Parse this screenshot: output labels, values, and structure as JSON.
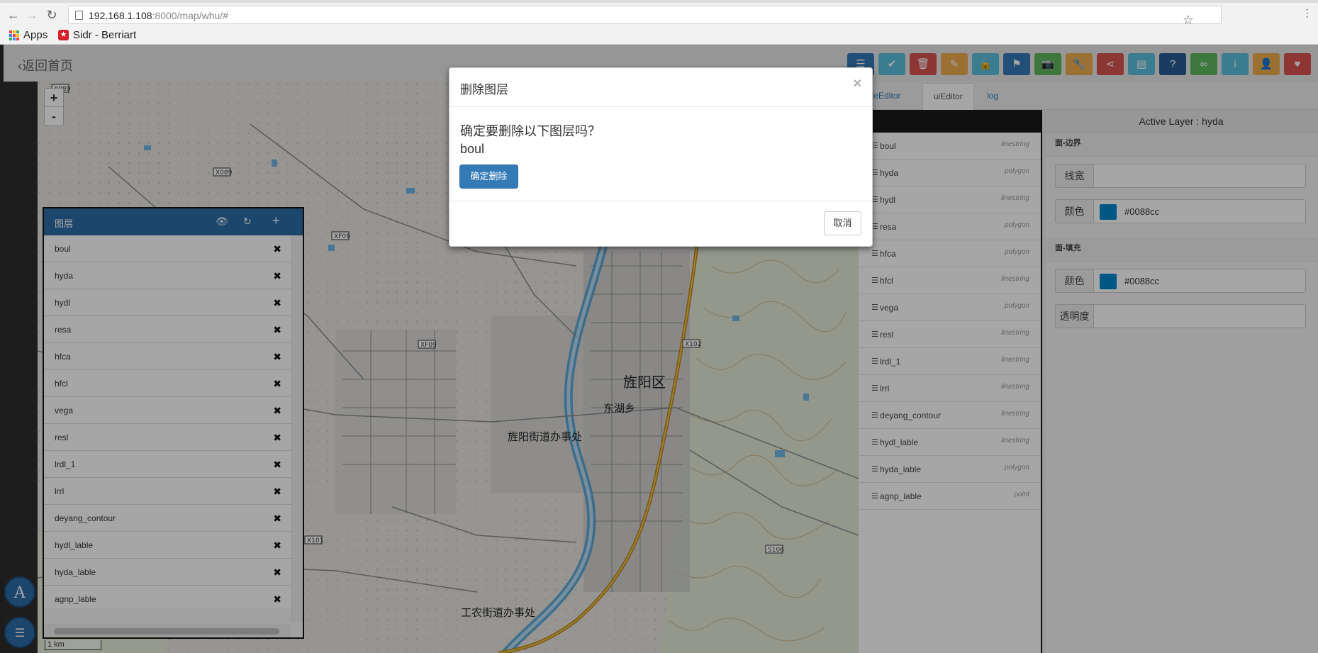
{
  "browser": {
    "url_host": "192.168.1.108",
    "url_rest": ":8000/map/whu/#",
    "bookmarks": [
      {
        "label": "Apps",
        "icon": "apps-grid-icon"
      },
      {
        "label": "Sidr - Berriart",
        "icon": "sidr-icon"
      }
    ]
  },
  "topbar": {
    "back_label": "返回首页",
    "toolbar_buttons": [
      {
        "icon": "list-icon",
        "color": "#337ab7"
      },
      {
        "icon": "check-icon",
        "color": "#5bc0de"
      },
      {
        "icon": "trash-icon",
        "color": "#d9534f"
      },
      {
        "icon": "pencil-icon",
        "color": "#f0ad4e"
      },
      {
        "icon": "lock-icon",
        "color": "#5bc0de"
      },
      {
        "icon": "flag-icon",
        "color": "#337ab7"
      },
      {
        "icon": "camera-icon",
        "color": "#5cb85c"
      },
      {
        "icon": "wrench-icon",
        "color": "#f0ad4e"
      },
      {
        "icon": "share-icon",
        "color": "#d9534f"
      },
      {
        "icon": "file-icon",
        "color": "#5bc0de"
      },
      {
        "icon": "question-icon",
        "color": "#2a5d96"
      },
      {
        "icon": "link-icon",
        "color": "#5cb85c"
      },
      {
        "icon": "info-icon",
        "color": "#5bc0de"
      },
      {
        "icon": "user-icon",
        "color": "#f0ad4e"
      },
      {
        "icon": "heart-icon",
        "color": "#d9534f"
      }
    ]
  },
  "map": {
    "zoom_in": "+",
    "zoom_out": "-",
    "scale": "1 km",
    "labels": {
      "district": "旌阳区",
      "east_lake": "东湖乡",
      "jingyang_office": "旌阳街道办事处",
      "gongnong_office": "工农街道办事处"
    }
  },
  "layer_panel": {
    "title": "图层",
    "layers": [
      "boul",
      "hyda",
      "hydl",
      "resa",
      "hfca",
      "hfcl",
      "vega",
      "resl",
      "lrdl_1",
      "lrrl",
      "deyang_contour",
      "hydl_lable",
      "hyda_lable",
      "agnp_lable"
    ]
  },
  "tabs": [
    {
      "label": "odeEditor",
      "active": false
    },
    {
      "label": "uiEditor",
      "active": true
    },
    {
      "label": "log",
      "active": false
    }
  ],
  "layer_types": [
    {
      "name": "boul",
      "type": "linestring"
    },
    {
      "name": "hyda",
      "type": "polygon"
    },
    {
      "name": "hydl",
      "type": "linestring"
    },
    {
      "name": "resa",
      "type": "polygon"
    },
    {
      "name": "hfca",
      "type": "polygon"
    },
    {
      "name": "hfcl",
      "type": "linestring"
    },
    {
      "name": "vega",
      "type": "polygon"
    },
    {
      "name": "resl",
      "type": "linestring"
    },
    {
      "name": "lrdl_1",
      "type": "linestring"
    },
    {
      "name": "lrrl",
      "type": "linestring"
    },
    {
      "name": "deyang_contour",
      "type": "linestring"
    },
    {
      "name": "hydl_lable",
      "type": "linestring"
    },
    {
      "name": "hyda_lable",
      "type": "polygon"
    },
    {
      "name": "agnp_lable",
      "type": "point"
    }
  ],
  "properties": {
    "title": "Active Layer : hyda",
    "border_section": "面-边界",
    "line_width_label": "线宽",
    "line_width_value": "",
    "border_color_label": "颜色",
    "border_color": "#0088cc",
    "fill_section": "面-填充",
    "fill_color_label": "颜色",
    "fill_color": "#0088cc",
    "opacity_label": "透明度",
    "opacity_value": ""
  },
  "fabs": [
    {
      "label": "A"
    },
    {
      "icon": "list-icon"
    }
  ],
  "modal": {
    "title": "删除图层",
    "close": "×",
    "question": "确定要删除以下图层吗？",
    "layer_name": "boul",
    "confirm_label": "确定删除",
    "cancel_label": "取消"
  }
}
